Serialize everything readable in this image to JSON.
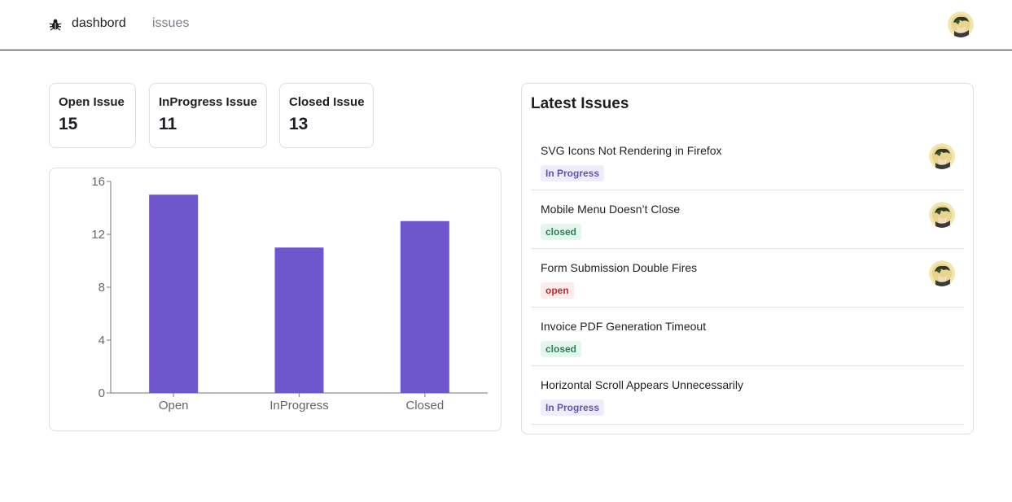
{
  "nav": {
    "brand_label": "dashbord",
    "links": [
      "issues"
    ],
    "logo_icon": "bug-icon",
    "avatar_icon": "user-avatar"
  },
  "stats": [
    {
      "label": "Open Issue",
      "value": "15"
    },
    {
      "label": "InProgress Issue",
      "value": "11"
    },
    {
      "label": "Closed Issue",
      "value": "13"
    }
  ],
  "chart_data": {
    "type": "bar",
    "categories": [
      "Open",
      "InProgress",
      "Closed"
    ],
    "values": [
      15,
      11,
      13
    ],
    "yticks": [
      0,
      4,
      8,
      12,
      16
    ],
    "ylim": [
      0,
      16
    ],
    "bar_color": "#6e56cf",
    "grid": false
  },
  "latest": {
    "title": "Latest Issues",
    "issues": [
      {
        "title": "SVG Icons Not Rendering in Firefox",
        "status": "In Progress",
        "status_kind": "progress",
        "assignee": true
      },
      {
        "title": "Mobile Menu Doesn’t Close",
        "status": "closed",
        "status_kind": "closed",
        "assignee": true
      },
      {
        "title": "Form Submission Double Fires",
        "status": "open",
        "status_kind": "open",
        "assignee": true
      },
      {
        "title": "Invoice PDF Generation Timeout",
        "status": "closed",
        "status_kind": "closed",
        "assignee": false
      },
      {
        "title": "Horizontal Scroll Appears Unnecessarily",
        "status": "In Progress",
        "status_kind": "progress",
        "assignee": false
      }
    ]
  },
  "colors": {
    "accent": "#6e56cf",
    "progress_bg": "#efedfb",
    "progress_fg": "#6550b9",
    "closed_bg": "#e7f6ec",
    "closed_fg": "#218358",
    "open_bg": "#fdecec",
    "open_fg": "#c62a2f"
  }
}
